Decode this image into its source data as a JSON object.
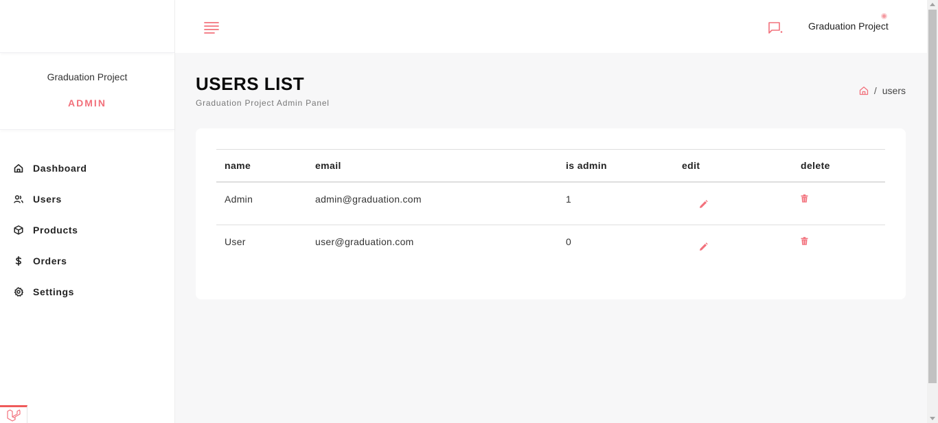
{
  "sidebar": {
    "profile_name": "Graduation Project",
    "profile_role": "ADMIN",
    "items": [
      {
        "label": "Dashboard",
        "icon": "home-icon"
      },
      {
        "label": "Users",
        "icon": "users-icon"
      },
      {
        "label": "Products",
        "icon": "box-icon"
      },
      {
        "label": "Orders",
        "icon": "dollar-icon"
      },
      {
        "label": "Settings",
        "icon": "gear-icon"
      }
    ]
  },
  "topbar": {
    "user_name": "Graduation Project",
    "accent_color": "#f2707b"
  },
  "page": {
    "title": "USERS LIST",
    "subtitle": "Graduation Project Admin Panel",
    "breadcrumb_current": "users"
  },
  "table": {
    "headers": [
      "name",
      "email",
      "is admin",
      "edit",
      "delete"
    ],
    "rows": [
      {
        "name": "Admin",
        "email": "admin@graduation.com",
        "is_admin": "1"
      },
      {
        "name": "User",
        "email": "user@graduation.com",
        "is_admin": "0"
      }
    ]
  }
}
